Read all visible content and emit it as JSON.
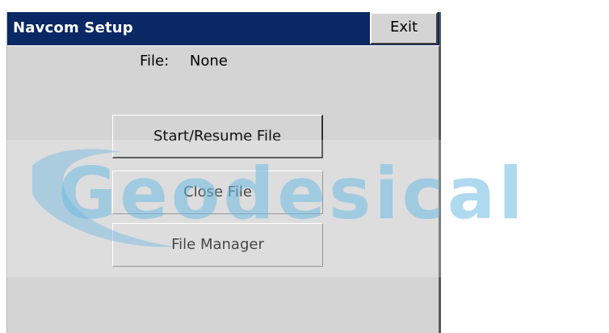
{
  "window": {
    "title": "Navcom Setup",
    "exit_label": "Exit"
  },
  "file": {
    "label": "File:",
    "value": "None"
  },
  "buttons": {
    "start_resume": "Start/Resume File",
    "close_file": "Close File",
    "file_manager": "File Manager"
  },
  "watermark": {
    "text": "Geodesical"
  },
  "colors": {
    "titlebar": "#0a2864",
    "window_bg": "#d4d4d4",
    "watermark": "#6eb9e1"
  }
}
